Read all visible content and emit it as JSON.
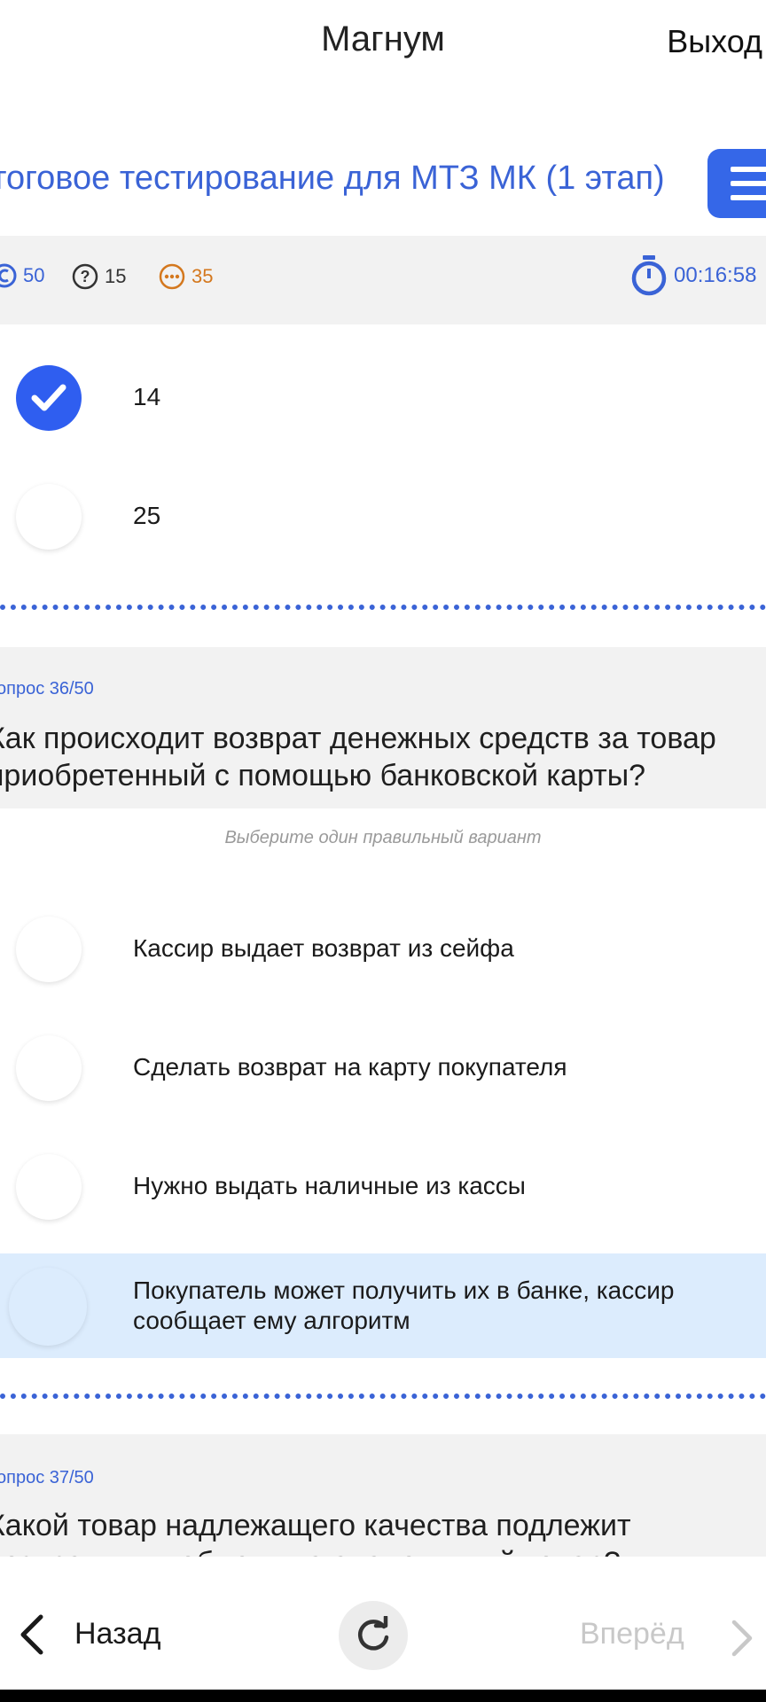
{
  "header": {
    "title": "Магнум",
    "exit_label": "Выход"
  },
  "test": {
    "title": "тоговое тестирование для МТЗ МК (1 этап)"
  },
  "stats": {
    "total": "50",
    "open": "15",
    "remaining": "35",
    "timer": "00:16:58"
  },
  "prev_question": {
    "options": [
      {
        "label": "14",
        "selected": true
      },
      {
        "label": "25",
        "selected": false
      }
    ]
  },
  "question36": {
    "counter": "опрос 36/50",
    "text_line1": "Как происходит возврат денежных средств за товар",
    "text_line2": "приобретенный с помощью банковской карты?",
    "hint": "Выберите один правильный вариант",
    "options": [
      {
        "label": "Кассир выдает возврат из сейфа"
      },
      {
        "label": "Сделать возврат на карту покупателя"
      },
      {
        "label": "Нужно выдать наличные из кассы"
      },
      {
        "label_line1": "Покупатель может получить их в банке, кассир",
        "label_line2": "сообщает ему алгоритм",
        "highlighted": true
      }
    ]
  },
  "question37": {
    "counter": "опрос 37/50",
    "text_line1": "Какой товар надлежащего качества подлежит",
    "text_line2": "возврату или обмену на аналогичный товар?"
  },
  "nav": {
    "back_label": "Назад",
    "forward_label": "Вперёд"
  },
  "colors": {
    "accent": "#3567e8",
    "highlight": "#dcecfd",
    "remaining": "#d4781e"
  }
}
